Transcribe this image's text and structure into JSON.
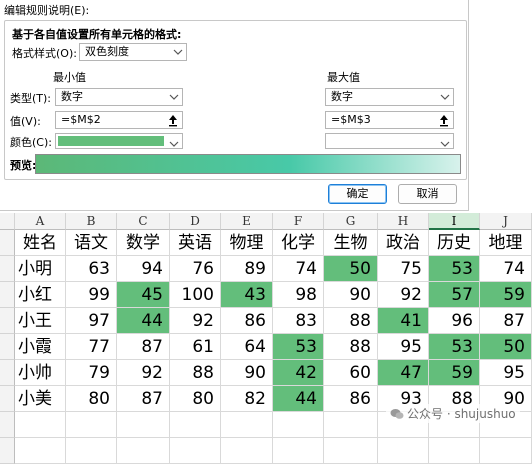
{
  "dialog": {
    "section_title": "编辑规则说明(E):",
    "heading": "基于各自值设置所有单元格的格式:",
    "format_style_label": "格式样式(O):",
    "format_style_value": "双色刻度",
    "min_header": "最小值",
    "max_header": "最大值",
    "type_label": "类型(T):",
    "min_type": "数字",
    "max_type": "数字",
    "value_label": "值(V):",
    "min_value": "=$M$2",
    "max_value": "=$M$3",
    "color_label": "颜色(C):",
    "min_color": "#63be7b",
    "max_color": "#ffffff",
    "preview_label": "预览:",
    "ok_label": "确定",
    "cancel_label": "取消"
  },
  "sheet": {
    "columns": [
      "A",
      "B",
      "C",
      "D",
      "E",
      "F",
      "G",
      "H",
      "I",
      "J"
    ],
    "active_column": "I",
    "headers": [
      "姓名",
      "语文",
      "数学",
      "英语",
      "物理",
      "化学",
      "生物",
      "政治",
      "历史",
      "地理"
    ],
    "rows": [
      {
        "name": "小明",
        "values": [
          "63",
          "94",
          "76",
          "89",
          "74",
          "50",
          "75",
          "53",
          "74"
        ]
      },
      {
        "name": "小红",
        "values": [
          "99",
          "45",
          "100",
          "43",
          "98",
          "90",
          "92",
          "57",
          "59"
        ]
      },
      {
        "name": "小王",
        "values": [
          "97",
          "44",
          "92",
          "86",
          "83",
          "88",
          "41",
          "96",
          "87"
        ]
      },
      {
        "name": "小霞",
        "values": [
          "77",
          "87",
          "61",
          "64",
          "53",
          "88",
          "95",
          "53",
          "50"
        ]
      },
      {
        "name": "小帅",
        "values": [
          "79",
          "92",
          "88",
          "90",
          "42",
          "60",
          "47",
          "59",
          "95"
        ]
      },
      {
        "name": "小美",
        "values": [
          "80",
          "87",
          "80",
          "82",
          "44",
          "86",
          "93",
          "88",
          "90"
        ]
      }
    ],
    "highlight_color": "#63be7b"
  },
  "watermark": "公众号 · shujushuo"
}
